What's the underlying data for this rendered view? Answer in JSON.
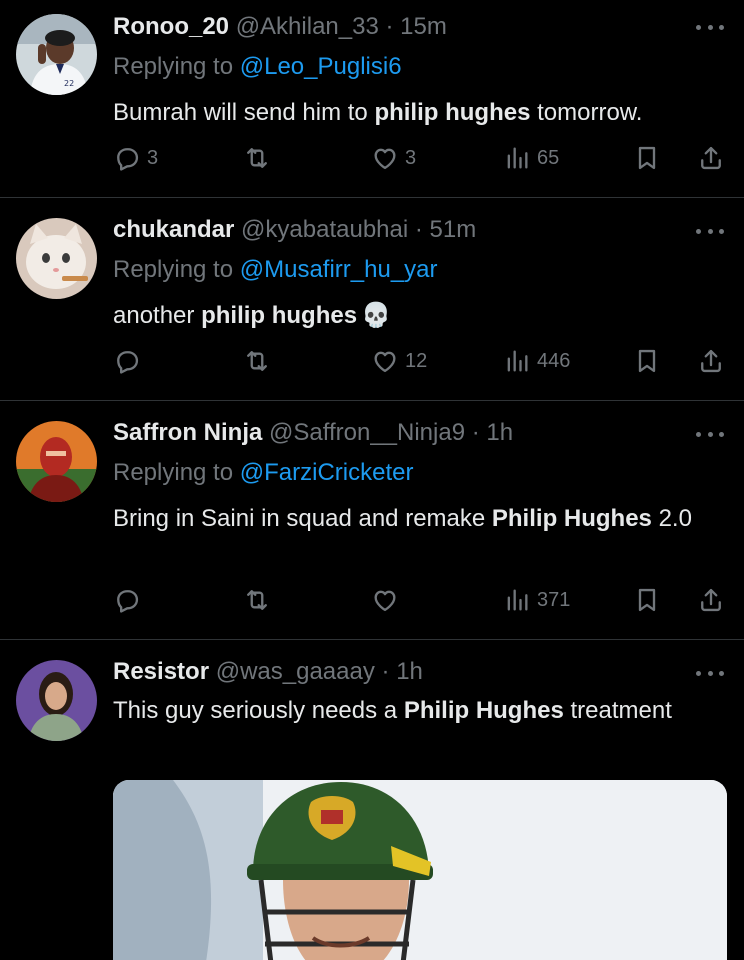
{
  "tweets": [
    {
      "name": "Ronoo_20",
      "handle": "@Akhilan_33",
      "time": "15m",
      "replying_prefix": "Replying to ",
      "replying_to": "@Leo_Puglisi6",
      "text_before": "Bumrah will send him to ",
      "text_bold": "philip hughes",
      "text_after": " tomorrow.",
      "replies": "3",
      "retweets": "",
      "likes": "3",
      "views": "65"
    },
    {
      "name": "chukandar",
      "handle": "@kyabataubhai",
      "time": "51m",
      "replying_prefix": "Replying to ",
      "replying_to": "@Musafirr_hu_yar",
      "text_before": "another ",
      "text_bold": "philip hughes",
      "text_after": "",
      "emoji": "💀",
      "replies": "",
      "retweets": "",
      "likes": "12",
      "views": "446"
    },
    {
      "name": "Saffron Ninja",
      "handle": "@Saffron__Ninja9",
      "time": "1h",
      "replying_prefix": "Replying to ",
      "replying_to": "@FarziCricketer",
      "text_before": "Bring in Saini in squad and remake ",
      "text_bold": "Philip Hughes",
      "text_after": " 2.0",
      "replies": "",
      "retweets": "",
      "likes": "",
      "views": "371"
    },
    {
      "name": "Resistor",
      "handle": "@was_gaaaay",
      "time": "1h",
      "text_before": "This guy seriously needs a ",
      "text_bold": "Philip Hughes",
      "text_after": " treatment"
    }
  ],
  "separator": " · ",
  "icons": {
    "more": "more-horizontal-icon",
    "reply": "reply-bubble-icon",
    "retweet": "retweet-icon",
    "like": "heart-icon",
    "views": "views-bar-chart-icon",
    "bookmark": "bookmark-icon",
    "share": "share-upload-icon"
  },
  "colors": {
    "background": "#000000",
    "text": "#e7e9ea",
    "muted": "#71767b",
    "link": "#1d9bf0",
    "divider": "#2f3336"
  }
}
